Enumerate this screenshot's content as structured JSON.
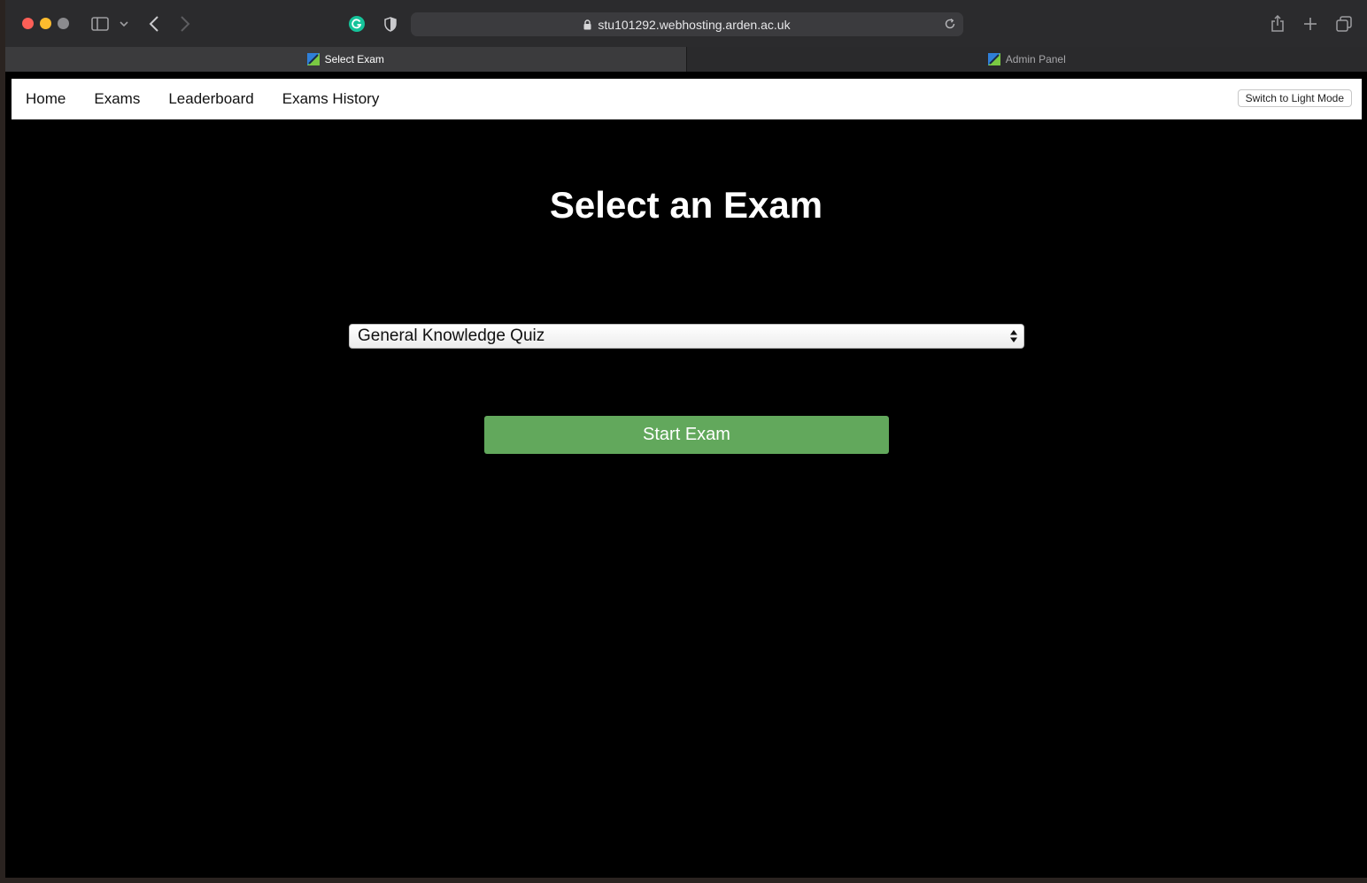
{
  "browser": {
    "url": "stu101292.webhosting.arden.ac.uk",
    "tabs": [
      {
        "label": "Select Exam",
        "active": true
      },
      {
        "label": "Admin Panel",
        "active": false
      }
    ]
  },
  "navbar": {
    "links": [
      "Home",
      "Exams",
      "Leaderboard",
      "Exams History"
    ],
    "theme_toggle_label": "Switch to Light Mode"
  },
  "main": {
    "heading": "Select an Exam",
    "exam_select": {
      "selected": "General Knowledge Quiz"
    },
    "start_button_label": "Start Exam"
  },
  "colors": {
    "page_background": "#000000",
    "navbar_background": "#ffffff",
    "start_button": "#62a85c"
  }
}
